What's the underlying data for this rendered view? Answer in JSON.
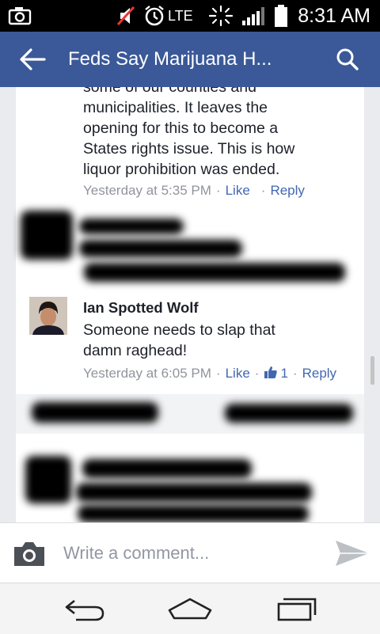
{
  "status_bar": {
    "network": "LTE",
    "time": "8:31 AM",
    "icons": [
      "camera-icon",
      "mute-icon",
      "alarm-icon",
      "signal-icon",
      "battery-icon"
    ]
  },
  "app_bar": {
    "title": "Feds Say Marijuana H...",
    "back_icon": "back-arrow-icon",
    "search_icon": "search-icon",
    "color": "#3b5998"
  },
  "comments": [
    {
      "text_lines": [
        "some of our counties and",
        "municipalities. It leaves the",
        "opening for this to become a",
        "States rights issue. This is how",
        "liquor prohibition was ended."
      ],
      "timestamp": "Yesterday at 5:35 PM",
      "like": "Like",
      "reply": "Reply"
    },
    {
      "author": "Ian Spotted Wolf",
      "text_lines": [
        "Someone needs to slap that",
        "damn raghead!"
      ],
      "timestamp": "Yesterday at 6:05 PM",
      "like": "Like",
      "like_count": "1",
      "reply": "Reply"
    }
  ],
  "composer": {
    "placeholder": "Write a comment..."
  },
  "nav_bar": {
    "icons": [
      "nav-back-icon",
      "nav-home-icon",
      "nav-recents-icon"
    ]
  }
}
